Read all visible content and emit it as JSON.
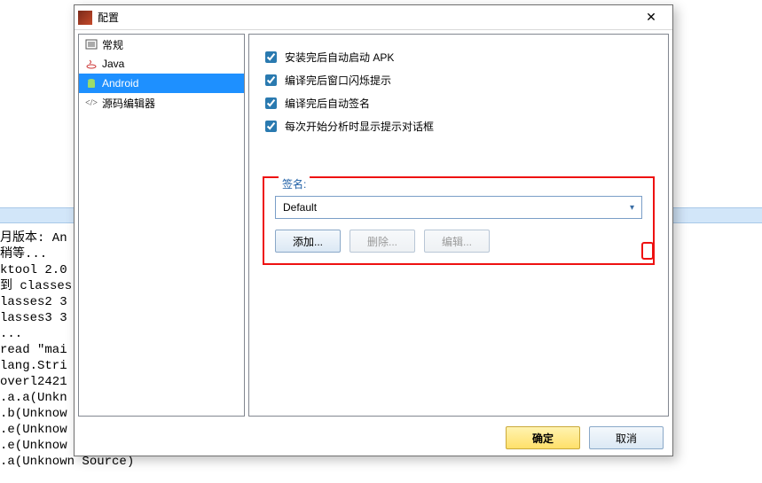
{
  "console_lines": "月版本: An\n稍等...\nktool 2.0\n到 classes\nlasses2 3\nlasses3 3\n...\nread \"mai\nlang.Stri\noverl2421\n.a.a(Unkn\n.b(Unknow\n.e(Unknow\n.e(Unknow\n.a(Unknown Source)",
  "dialog": {
    "title": "配置",
    "close": "✕"
  },
  "sidebar": {
    "items": [
      {
        "label": "常规",
        "icon": "⧉"
      },
      {
        "label": "Java",
        "icon": "☕"
      },
      {
        "label": "Android",
        "icon": "▌"
      },
      {
        "label": "源码编辑器",
        "icon": "</>"
      }
    ],
    "selected_index": 2
  },
  "content": {
    "checks": [
      "安装完后自动启动 APK",
      "编译完后窗口闪烁提示",
      "编译完后自动签名",
      "每次开始分析时显示提示对话框"
    ],
    "sign_group": {
      "legend": "签名:",
      "combo_value": "Default",
      "buttons": {
        "add": "添加...",
        "delete": "删除...",
        "edit": "编辑..."
      }
    }
  },
  "footer": {
    "ok": "确定",
    "cancel": "取消"
  }
}
